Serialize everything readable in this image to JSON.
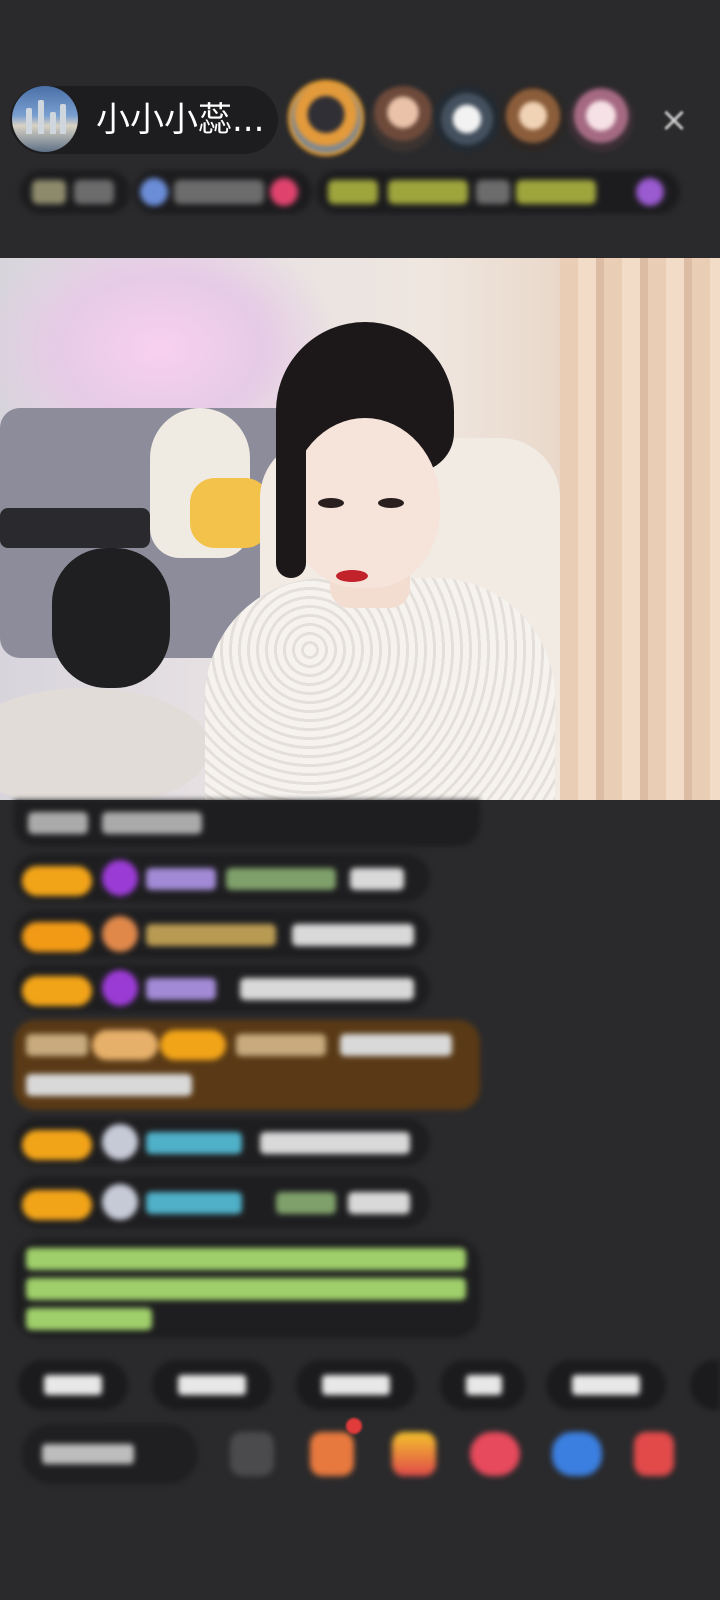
{
  "header": {
    "host_name": "小小小蕊...",
    "close_label": "×"
  },
  "colors": {
    "background": "#2a2a2c",
    "badge": "#f2a418",
    "highlight_bg": "#5a3a16"
  },
  "icons": {
    "close": "close-icon",
    "bottom": [
      "chat-icon",
      "gift-box-icon",
      "shop-icon",
      "heart-icon",
      "game-icon",
      "red-packet-icon"
    ]
  }
}
